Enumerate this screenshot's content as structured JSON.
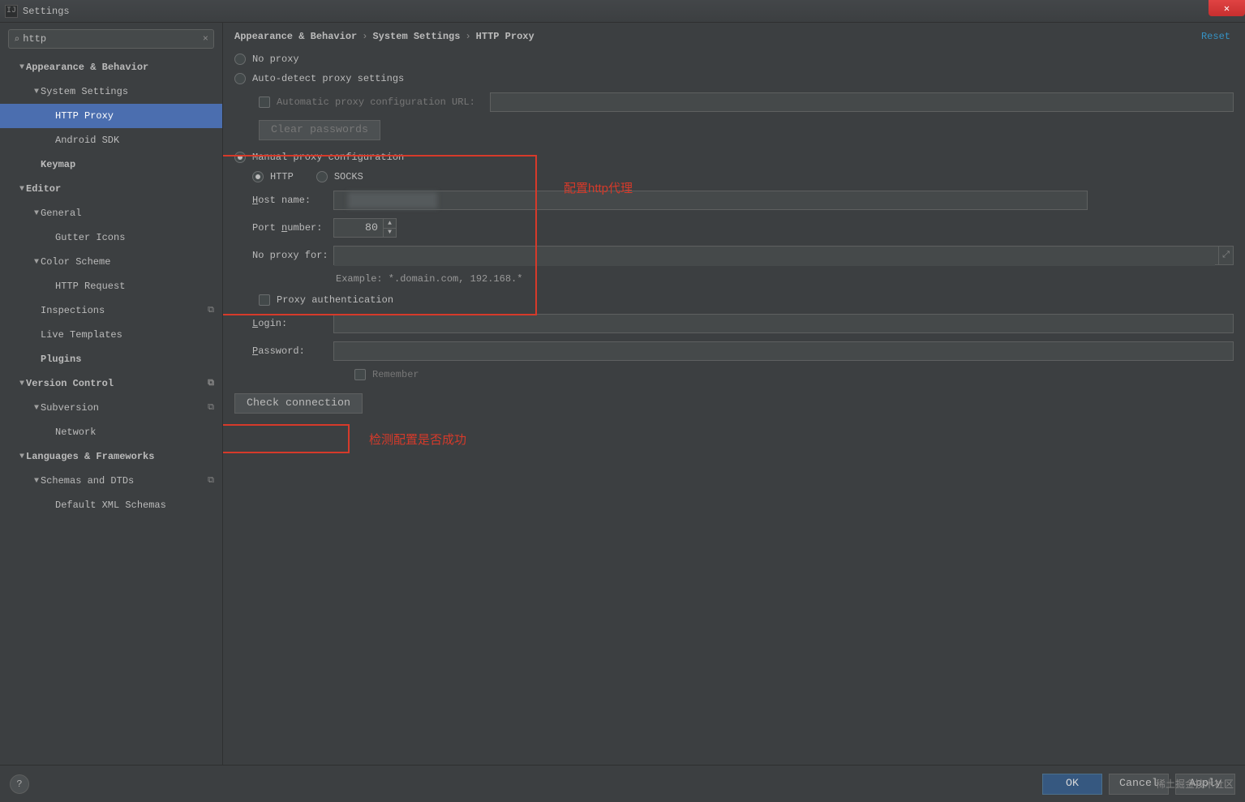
{
  "window": {
    "title": "Settings"
  },
  "search": {
    "value": "http"
  },
  "sidebar": {
    "items": [
      {
        "label": "Appearance & Behavior",
        "lvl": 0,
        "exp": "▼",
        "bold": true
      },
      {
        "label": "System Settings",
        "lvl": 1,
        "exp": "▼",
        "bold": false
      },
      {
        "label": "HTTP Proxy",
        "lvl": 2,
        "exp": "",
        "bold": false,
        "sel": true
      },
      {
        "label": "Android SDK",
        "lvl": 2,
        "exp": "",
        "bold": false
      },
      {
        "label": "Keymap",
        "lvl": 1,
        "exp": "",
        "bold": true
      },
      {
        "label": "Editor",
        "lvl": 0,
        "exp": "▼",
        "bold": true
      },
      {
        "label": "General",
        "lvl": 1,
        "exp": "▼",
        "bold": false
      },
      {
        "label": "Gutter Icons",
        "lvl": 2,
        "exp": "",
        "bold": false
      },
      {
        "label": "Color Scheme",
        "lvl": 1,
        "exp": "▼",
        "bold": false
      },
      {
        "label": "HTTP Request",
        "lvl": 2,
        "exp": "",
        "bold": false
      },
      {
        "label": "Inspections",
        "lvl": 1,
        "exp": "",
        "bold": false,
        "ov": true
      },
      {
        "label": "Live Templates",
        "lvl": 1,
        "exp": "",
        "bold": false
      },
      {
        "label": "Plugins",
        "lvl": 1,
        "exp": "",
        "bold": true
      },
      {
        "label": "Version Control",
        "lvl": 0,
        "exp": "▼",
        "bold": true,
        "ov": true
      },
      {
        "label": "Subversion",
        "lvl": 1,
        "exp": "▼",
        "bold": false,
        "ov": true
      },
      {
        "label": "Network",
        "lvl": 2,
        "exp": "",
        "bold": false
      },
      {
        "label": "Languages & Frameworks",
        "lvl": 0,
        "exp": "▼",
        "bold": true
      },
      {
        "label": "Schemas and DTDs",
        "lvl": 1,
        "exp": "▼",
        "bold": false,
        "ov": true
      },
      {
        "label": "Default XML Schemas",
        "lvl": 2,
        "exp": "",
        "bold": false
      }
    ]
  },
  "breadcrumb": {
    "c1": "Appearance & Behavior",
    "c2": "System Settings",
    "c3": "HTTP Proxy"
  },
  "reset": "Reset",
  "proxy": {
    "no_proxy": "No proxy",
    "auto_detect": "Auto-detect proxy settings",
    "auto_url_label": "Automatic proxy configuration URL:",
    "clear_pw": "Clear passwords",
    "manual": "Manual proxy configuration",
    "http": "HTTP",
    "socks": "SOCKS",
    "host_label": "Host name:",
    "port_label": "Port number:",
    "port_value": "80",
    "noproxy_label": "No proxy for:",
    "example": "Example: *.domain.com, 192.168.*",
    "auth_label": "Proxy authentication",
    "login_label": "Login:",
    "pw_label": "Password:",
    "remember": "Remember",
    "check": "Check connection"
  },
  "annotations": {
    "a1": "配置http代理",
    "a2": "检测配置是否成功"
  },
  "footer": {
    "ok": "OK",
    "cancel": "Cancel",
    "apply": "Apply"
  },
  "watermark": "稀土掘金技术社区"
}
